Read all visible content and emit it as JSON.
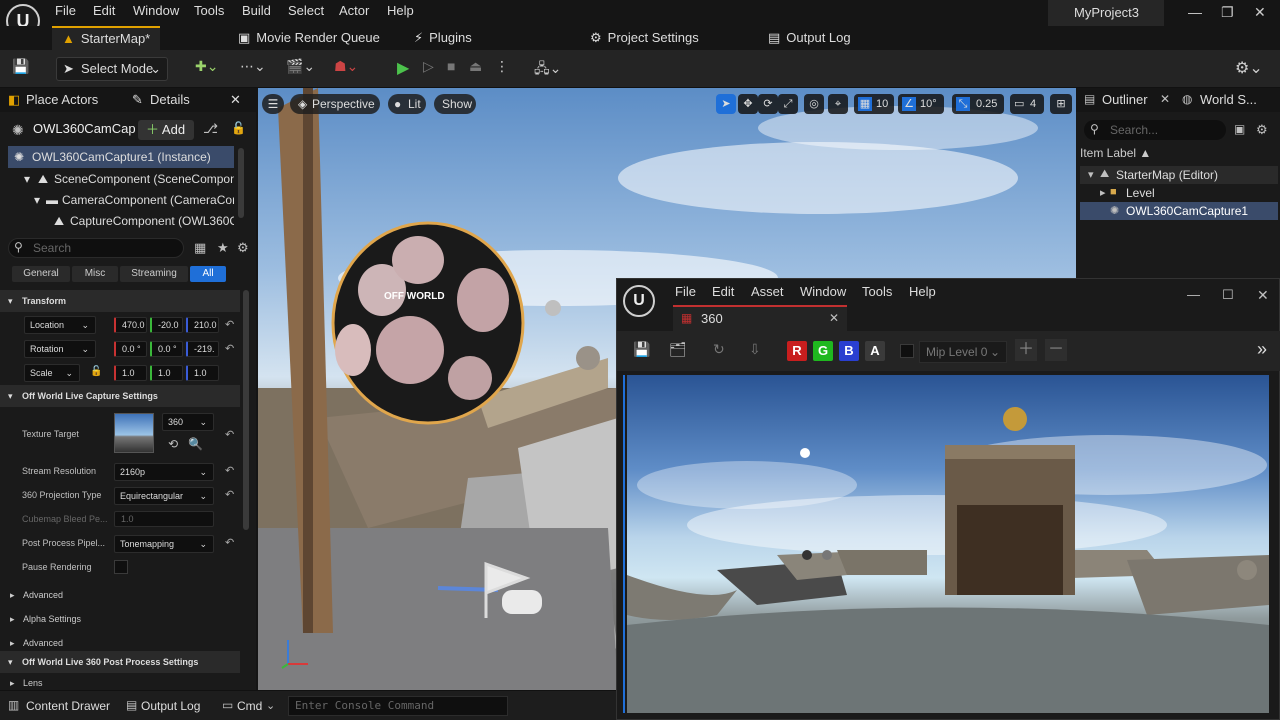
{
  "menubar": {
    "logo": "U",
    "items": [
      "File",
      "Edit",
      "Window",
      "Tools",
      "Build",
      "Select",
      "Actor",
      "Help"
    ],
    "project": "MyProject3"
  },
  "tabs": [
    {
      "label": "StarterMap*",
      "icon": "level-icon"
    },
    {
      "label": "Movie Render Queue",
      "icon": "movie-icon"
    },
    {
      "label": "Plugins",
      "icon": "plug-icon"
    },
    {
      "label": "Project Settings",
      "icon": "gear-icon"
    },
    {
      "label": "Output Log",
      "icon": "log-icon"
    }
  ],
  "toolbar": {
    "select_mode": "Select Mode"
  },
  "left_panel": {
    "tab_place": "Place Actors",
    "tab_details": "Details",
    "actor_name": "OWL360CamCaptu",
    "add_label": "Add",
    "tree": [
      "OWL360CamCapture1 (Instance)",
      "SceneComponent (SceneCompone",
      "CameraComponent (CameraComp",
      "CaptureComponent (OWL360Ca"
    ],
    "search_placeholder": "Search",
    "filters": [
      "General",
      "Misc",
      "Streaming",
      "All"
    ],
    "transform_section": "Transform",
    "location_label": "Location",
    "location": [
      "470.0",
      "-20.0",
      "210.0"
    ],
    "rotation_label": "Rotation",
    "rotation": [
      "0.0 °",
      "0.0 °",
      "-219."
    ],
    "scale_label": "Scale",
    "scale": [
      "1.0",
      "1.0",
      "1.0"
    ],
    "owl_section": "Off World Live Capture Settings",
    "texture_target_label": "Texture Target",
    "texture_target_value": "360",
    "stream_res_label": "Stream Resolution",
    "stream_res_value": "2160p",
    "projection_label": "360 Projection Type",
    "projection_value": "Equirectangular",
    "cubemap_label": "Cubemap Bleed Pe...",
    "cubemap_value": "1.0",
    "postprocess_label": "Post Process Pipel...",
    "postprocess_value": "Tonemapping",
    "pause_label": "Pause Rendering",
    "advanced1": "Advanced",
    "alpha": "Alpha Settings",
    "advanced2": "Advanced",
    "pp_section": "Off World Live 360 Post Process Settings",
    "lens": "Lens"
  },
  "viewport": {
    "perspective": "Perspective",
    "lit": "Lit",
    "show": "Show",
    "grid": "10",
    "angle": "10°",
    "scale": "0.25",
    "cams": "4",
    "sphere_text": "OFF WORLD"
  },
  "outliner": {
    "tab": "Outliner",
    "tab2": "World S...",
    "search_placeholder": "Search...",
    "header": "Item Label ▲",
    "items": [
      "StarterMap (Editor)",
      "Level",
      "OWL360CamCapture1"
    ]
  },
  "bottombar": {
    "content_drawer": "Content Drawer",
    "output_log": "Output Log",
    "cmd": "Cmd",
    "console_placeholder": "Enter Console Command"
  },
  "texture_editor": {
    "menu": [
      "File",
      "Edit",
      "Asset",
      "Window",
      "Tools",
      "Help"
    ],
    "tab": "360",
    "channels": [
      "R",
      "G",
      "B",
      "A"
    ],
    "mip": "Mip Level 0",
    "colors": {
      "r": "#c81e1e",
      "g": "#1fb81f",
      "b": "#2a3fd0",
      "a": "#3a3a3a"
    }
  }
}
